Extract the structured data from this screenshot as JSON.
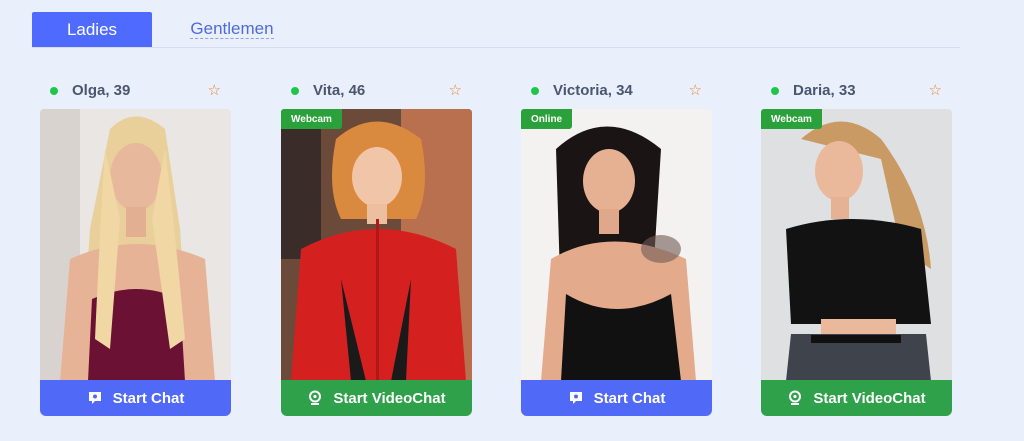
{
  "tabs": [
    {
      "label": "Ladies",
      "active": true
    },
    {
      "label": "Gentlemen",
      "active": false
    }
  ],
  "cards": [
    {
      "name": "Olga, 39",
      "badge": "",
      "button": "Start Chat",
      "button_icon": "chat-bubble-icon",
      "online_color": "#1fc64b"
    },
    {
      "name": "Vita, 46",
      "badge": "Webcam",
      "button": "Start VideoChat",
      "button_icon": "webcam-icon",
      "online_color": "#1fc64b"
    },
    {
      "name": "Victoria, 34",
      "badge": "Online",
      "button": "Start Chat",
      "button_icon": "chat-bubble-icon",
      "online_color": "#1fc64b"
    },
    {
      "name": "Daria, 33",
      "badge": "Webcam",
      "button": "Start VideoChat",
      "button_icon": "webcam-icon",
      "online_color": "#1fc64b"
    }
  ],
  "colors": {
    "accent": "#4f6bff",
    "chat_button": "#5069f7",
    "video_button": "#2fa14a",
    "badge": "#2aa13a",
    "star": "#e0873a"
  }
}
